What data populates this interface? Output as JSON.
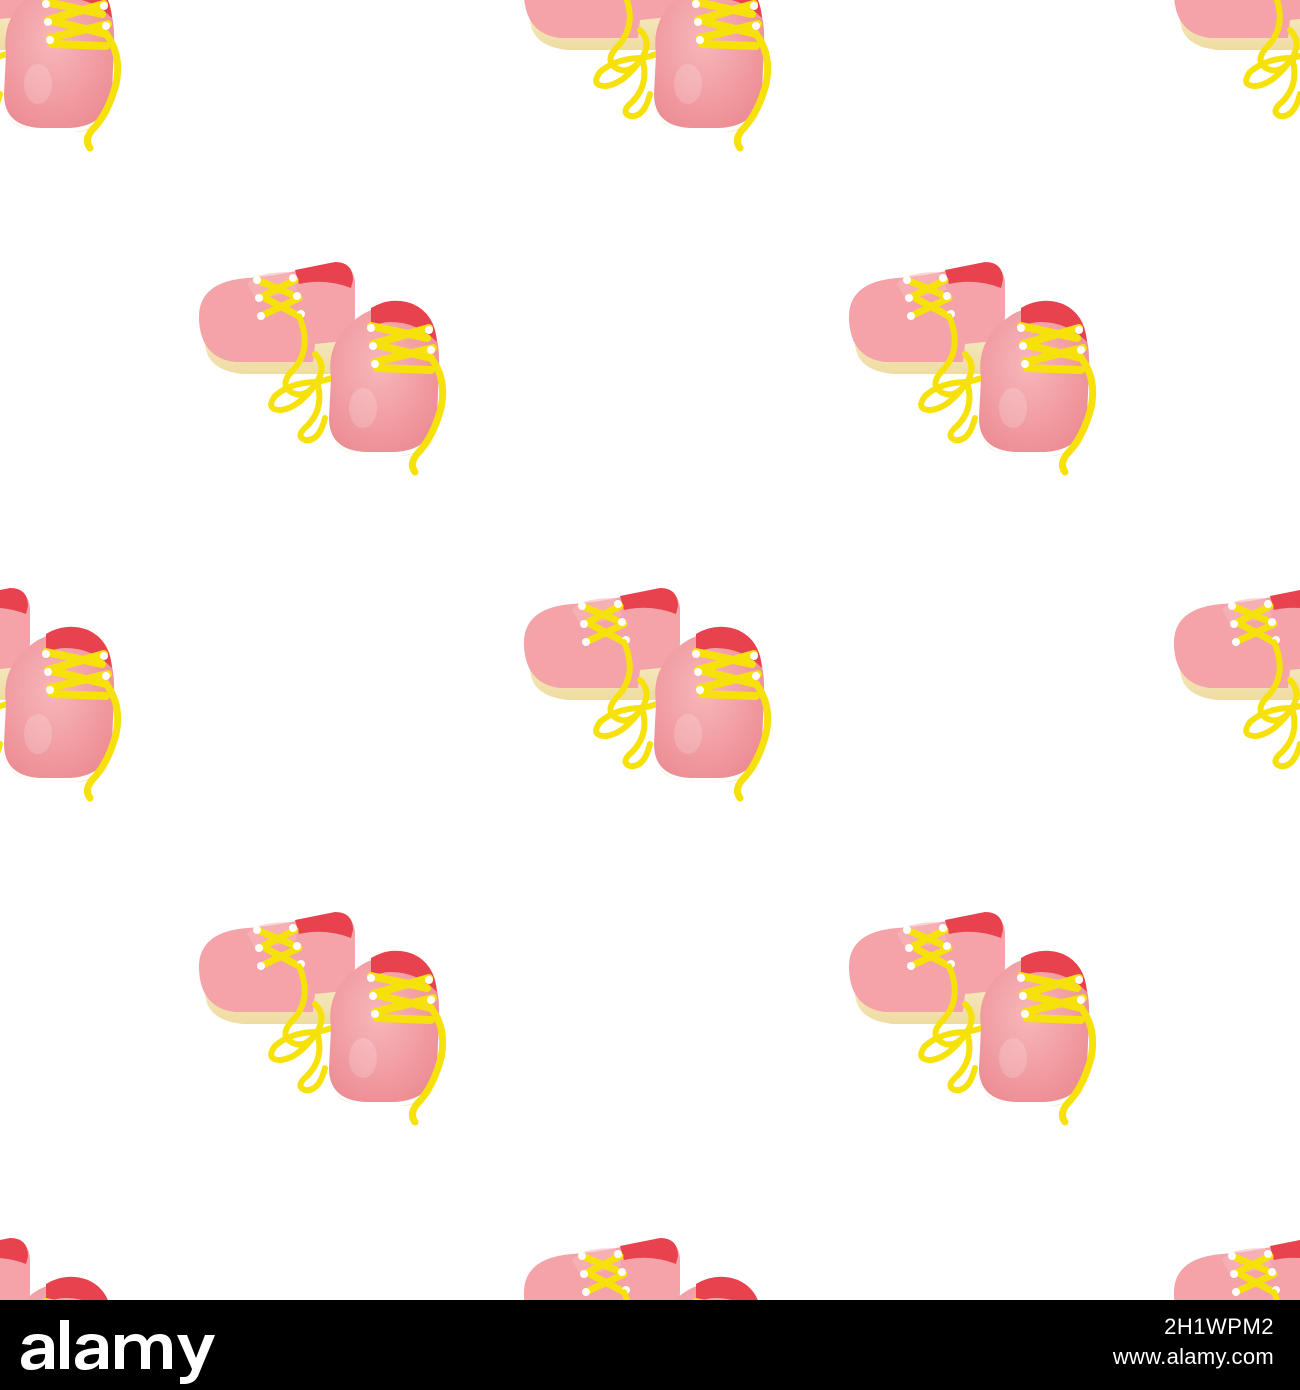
{
  "colors": {
    "background": "#ffffff",
    "shoe_pink": "#f4a3a8",
    "shoe_pink_dark": "#ec8a91",
    "shoe_inner": "#e8424f",
    "sole": "#f6e6b8",
    "lace": "#f7e10a",
    "eyelet": "#ffffff",
    "footer": "#000000",
    "footer_text": "#ffffff"
  },
  "pattern": {
    "motif": "pair-of-pink-shoes-with-yellow-laces",
    "icon": "shoes-icon"
  },
  "footer": {
    "logo_text": "alamy",
    "image_id": "2H1WPM2",
    "image_url": "www.alamy.com"
  }
}
